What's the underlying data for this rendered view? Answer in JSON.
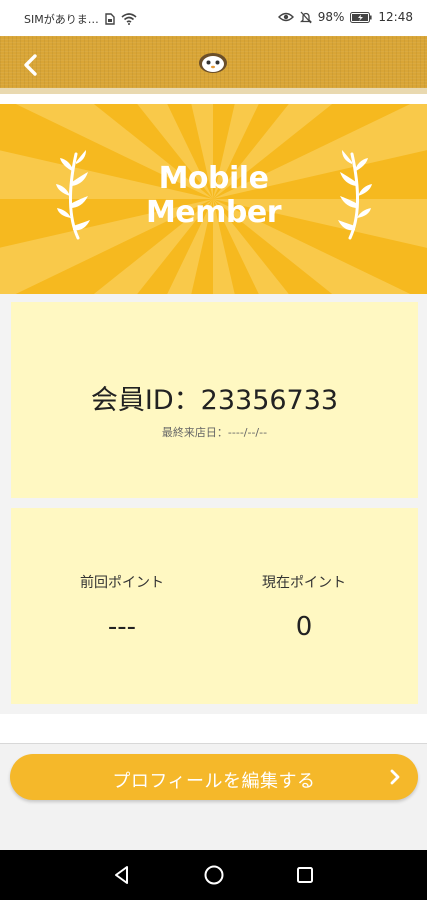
{
  "status_bar": {
    "carrier": "SIMがありま…",
    "battery_percent": "98%",
    "time": "12:48",
    "icons": [
      "sim-card-icon",
      "wifi-icon",
      "eye-comfort-icon",
      "silent-bell-icon",
      "battery-charging-icon"
    ]
  },
  "header": {
    "back_icon": "chevron-left-icon",
    "logo_icon": "mascot-face-icon",
    "color": "#d9a536"
  },
  "banner": {
    "title_line1": "Mobile",
    "title_line2": "Member",
    "background_color": "#f6b91f",
    "laurel_icon": "laurel-branch-icon"
  },
  "member": {
    "id_text": "会員ID：23356733",
    "last_visit_text": "最終来店日：----/--/--"
  },
  "points": {
    "previous_label": "前回ポイント",
    "previous_value": "---",
    "current_label": "現在ポイント",
    "current_value": "0",
    "card_color": "#fff8c2"
  },
  "actions": {
    "edit_profile_label": "プロフィールを編集する",
    "edit_profile_icon": "chevron-right-icon",
    "button_color": "#f5b82a"
  },
  "nav_bar": {
    "icons": [
      "nav-back-icon",
      "nav-home-icon",
      "nav-recents-icon"
    ]
  }
}
